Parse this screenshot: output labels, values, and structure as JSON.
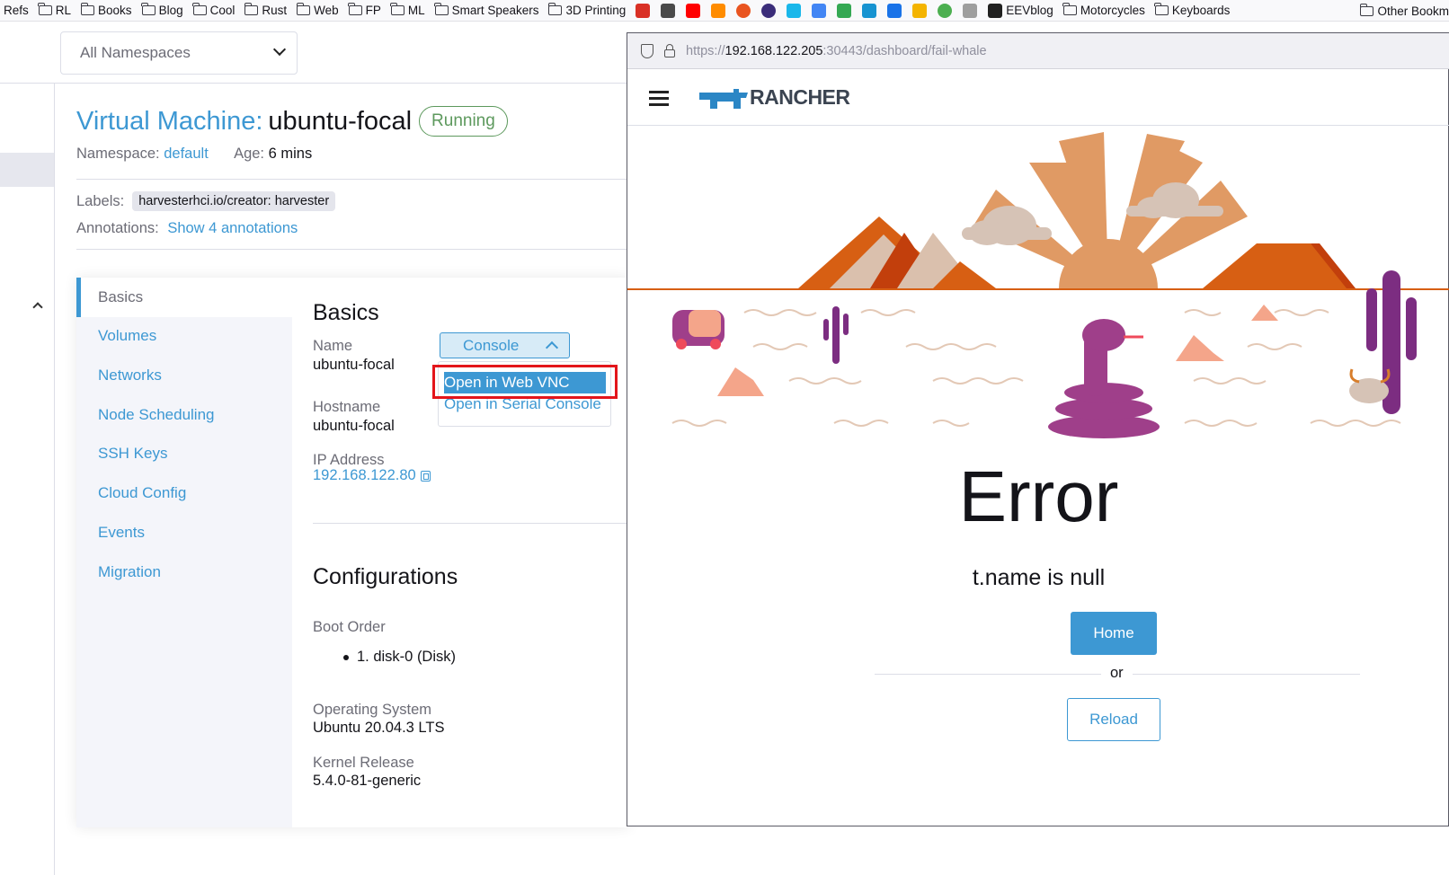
{
  "bookmarks": {
    "left": [
      "Refs",
      "RL",
      "Books",
      "Blog",
      "Cool",
      "Rust",
      "Web",
      "FP",
      "ML",
      "Smart Speakers",
      "3D Printing"
    ],
    "favicon_colors": [
      "#d93025",
      "#4a4a4a",
      "#ff0000",
      "#ff8c00",
      "#e95420",
      "#3b2d7a",
      "#1ab7ea",
      "#4285f4",
      "#34a853",
      "#1793d1",
      "#1a73e8",
      "#f4b400",
      "#4caf50",
      "#9e9e9e",
      "#202020"
    ],
    "eev": "EEVblog",
    "right": [
      "Motorcycles",
      "Keyboards"
    ],
    "other": "Other Bookm"
  },
  "namespace_select": "All Namespaces",
  "vm": {
    "kind": "Virtual Machine:",
    "name": "ubuntu-focal",
    "status": "Running",
    "namespace_label": "Namespace:",
    "namespace": "default",
    "age_label": "Age:",
    "age": "6 mins",
    "labels_label": "Labels:",
    "label_chip": "harvesterhci.io/creator: harvester",
    "annotations_label": "Annotations:",
    "annotations_link": "Show 4 annotations"
  },
  "tabs": [
    "Basics",
    "Volumes",
    "Networks",
    "Node Scheduling",
    "SSH Keys",
    "Cloud Config",
    "Events",
    "Migration"
  ],
  "basics": {
    "heading": "Basics",
    "name_label": "Name",
    "name_value": "ubuntu-focal",
    "hostname_label": "Hostname",
    "hostname_value": "ubuntu-focal",
    "ip_label": "IP Address",
    "ip_value": "192.168.122.80"
  },
  "console": {
    "button": "Console",
    "items": [
      "Open in Web VNC",
      "Open in Serial Console"
    ]
  },
  "configurations": {
    "heading": "Configurations",
    "boot_label": "Boot Order",
    "boot_item": "1. disk-0 (Disk)",
    "os_label": "Operating System",
    "os_value": "Ubuntu 20.04.3 LTS",
    "kernel_label": "Kernel Release",
    "kernel_value": "5.4.0-81-generic"
  },
  "popup": {
    "url_prefix": "https://",
    "url_host": "192.168.122.205",
    "url_rest": ":30443/dashboard/fail-whale",
    "logo": "RANCHER",
    "error_title": "Error",
    "error_message": "t.name is null",
    "home": "Home",
    "or": "or",
    "reload": "Reload"
  },
  "colors": {
    "accent": "#3d98d3",
    "running": "#5d995d",
    "highlight_border": "#e3151b"
  }
}
